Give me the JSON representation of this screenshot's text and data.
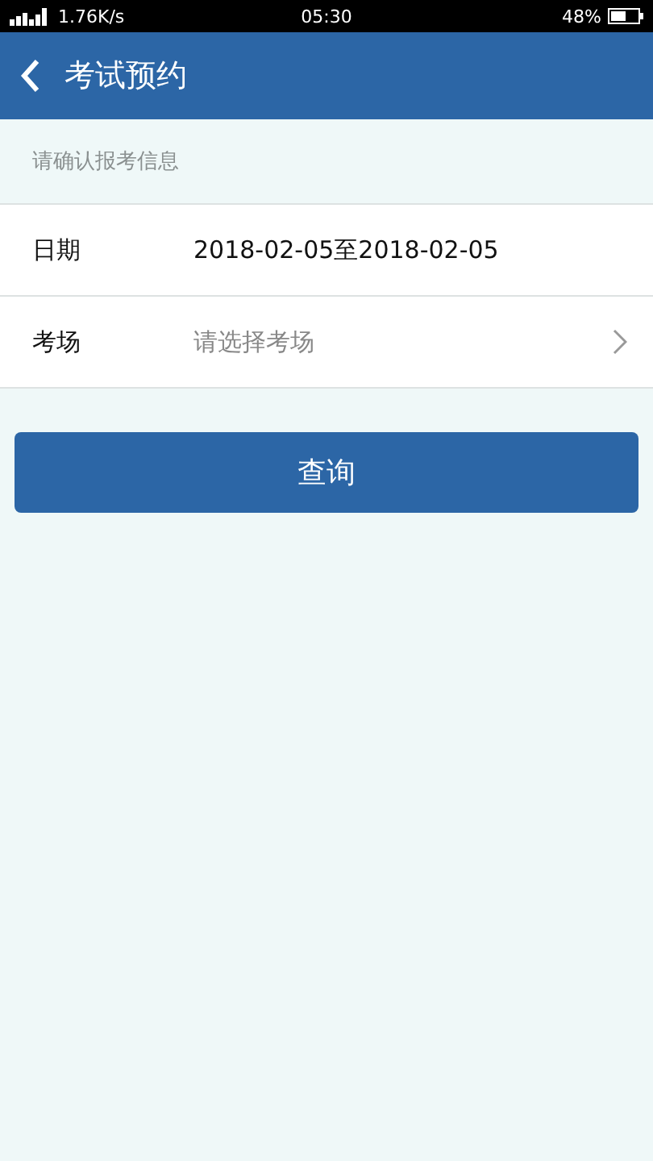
{
  "status_bar": {
    "network_speed": "1.76K/s",
    "time": "05:30",
    "battery": "48%"
  },
  "header": {
    "title": "考试预约"
  },
  "section_hint": "请确认报考信息",
  "form_rows": [
    {
      "kind": "value",
      "label": "日期",
      "value": "2018-02-05至2018-02-05"
    },
    {
      "kind": "select",
      "label": "考场",
      "placeholder": "请选择考场"
    }
  ],
  "buttons": [
    "查询"
  ]
}
